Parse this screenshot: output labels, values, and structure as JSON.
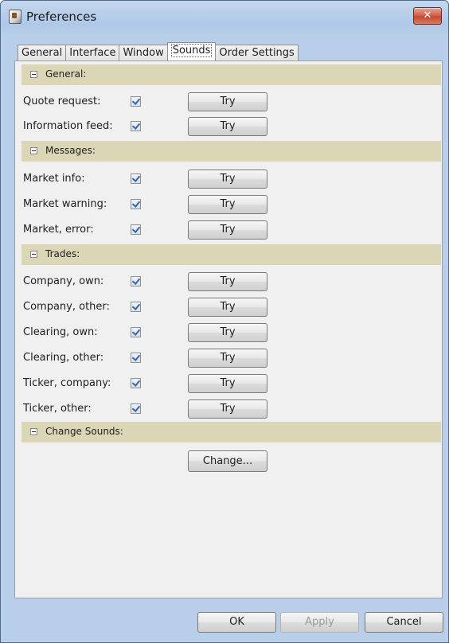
{
  "window": {
    "title": "Preferences",
    "close_label": "✕"
  },
  "tabs": [
    {
      "label": "General"
    },
    {
      "label": "Interface"
    },
    {
      "label": "Window"
    },
    {
      "label": "Sounds",
      "active": true
    },
    {
      "label": "Order Settings"
    }
  ],
  "sections": {
    "general": {
      "title": "General:",
      "rows": [
        {
          "label": "Quote request:",
          "checked": true,
          "button": "Try"
        },
        {
          "label": "Information feed:",
          "checked": true,
          "button": "Try"
        }
      ]
    },
    "messages": {
      "title": "Messages:",
      "rows": [
        {
          "label": "Market info:",
          "checked": true,
          "button": "Try"
        },
        {
          "label": "Market warning:",
          "checked": true,
          "button": "Try"
        },
        {
          "label": "Market, error:",
          "checked": true,
          "button": "Try"
        }
      ]
    },
    "trades": {
      "title": "Trades:",
      "rows": [
        {
          "label": "Company, own:",
          "checked": true,
          "button": "Try"
        },
        {
          "label": "Company, other:",
          "checked": true,
          "button": "Try"
        },
        {
          "label": "Clearing, own:",
          "checked": true,
          "button": "Try"
        },
        {
          "label": "Clearing, other:",
          "checked": true,
          "button": "Try"
        },
        {
          "label": "Ticker, company:",
          "checked": true,
          "button": "Try"
        },
        {
          "label": "Ticker, other:",
          "checked": true,
          "button": "Try"
        }
      ]
    },
    "change_sounds": {
      "title": "Change Sounds:",
      "button": "Change..."
    }
  },
  "footer": {
    "ok": "OK",
    "apply": "Apply",
    "cancel": "Cancel"
  },
  "colors": {
    "section_header": "#dbd6b6",
    "title_bar": "#b9cfe9",
    "close_button": "#c14a33"
  }
}
